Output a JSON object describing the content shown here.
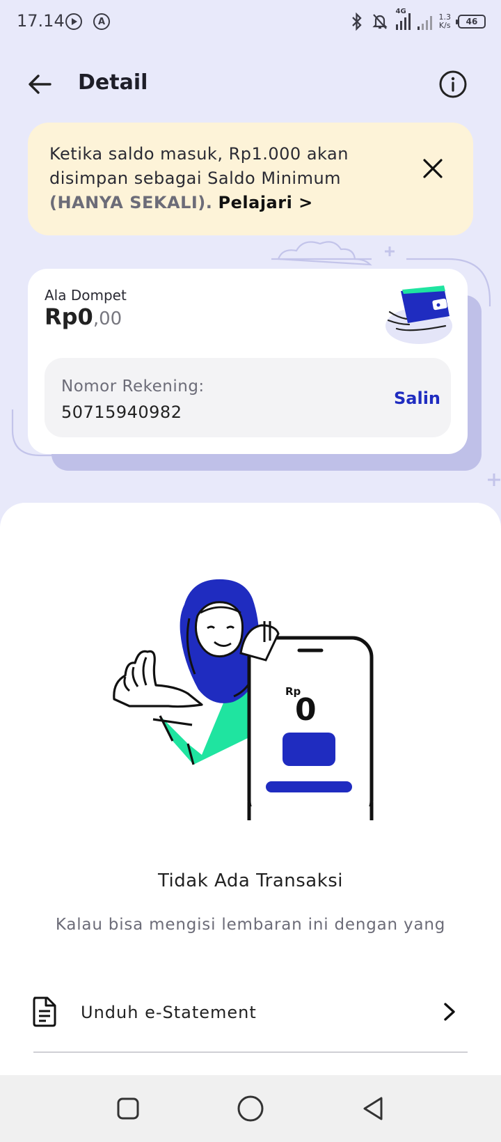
{
  "status_bar": {
    "time": "17.14",
    "network_type": "4G",
    "net_speed_value": "1.3",
    "net_speed_unit": "K/s",
    "battery": "46",
    "left_icon_2_letter": "A"
  },
  "header": {
    "title": "Detail"
  },
  "notice": {
    "text": "Ketika saldo masuk, Rp1.000 akan disimpan sebagai Saldo Minimum",
    "emphasis": "(HANYA SEKALI).",
    "link": "Pelajari >"
  },
  "wallet": {
    "name": "Ala Dompet",
    "balance_main": "Rp0",
    "balance_decimal": ",00",
    "account_label": "Nomor Rekening:",
    "account_number": "50715940982",
    "copy_label": "Salin"
  },
  "illustration": {
    "currency": "Rp",
    "amount": "0"
  },
  "empty_state": {
    "title": "Tidak Ada Transaksi",
    "description": "Kalau bisa mengisi lembaran ini dengan yang"
  },
  "menu": {
    "estatement_label": "Unduh e-Statement"
  },
  "colors": {
    "background": "#e8e9fa",
    "accent": "#1f2cc0",
    "notice_bg": "#fdf3d8",
    "green": "#1fe4a0"
  }
}
